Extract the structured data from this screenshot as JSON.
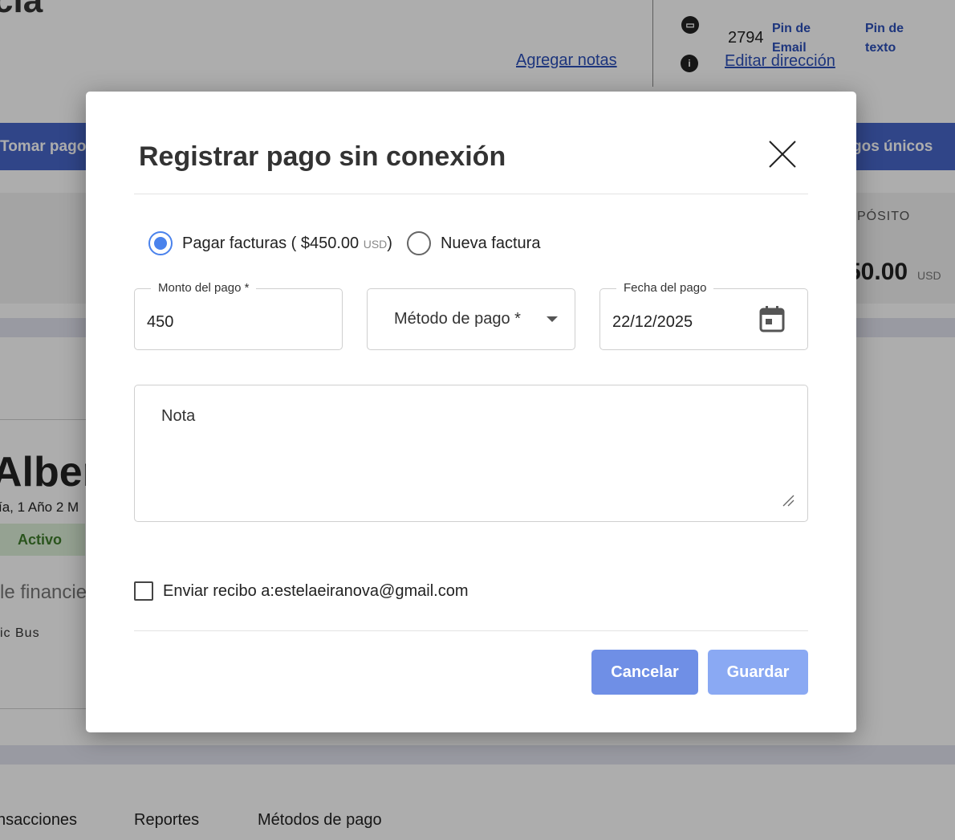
{
  "background": {
    "page_title_fragment": "cia",
    "add_notes_link": "Agregar notas",
    "edit_address_link": "Editar dirección",
    "pin_code": "2794",
    "pin_email_label": "Pin de Email",
    "pin_text_label": "Pin de texto",
    "take_payment_button": "Tomar pago",
    "one_time_charges_button": "gos únicos",
    "deposit_label": "PÓSITO",
    "deposit_amount": "50.00",
    "deposit_currency": "USD",
    "student_name": "Albert",
    "student_age": "ía, 1 Año 2 M",
    "status_badge": "Activo",
    "financial_fragment": "le financie",
    "bus_fragment": "ic Bus",
    "tabs": [
      "nsacciones",
      "Reportes",
      "Métodos de pago"
    ]
  },
  "modal": {
    "title": "Registrar pago sin conexión",
    "radio_options": {
      "pay_invoices_prefix": "Pagar facturas ( $450.00",
      "pay_invoices_currency": "USD",
      "pay_invoices_suffix": ")",
      "new_invoice": "Nueva factura",
      "selected": "pay_invoices"
    },
    "amount": {
      "label": "Monto del pago *",
      "value": "450"
    },
    "method": {
      "label": "Método de pago *"
    },
    "date": {
      "label": "Fecha del pago",
      "value": "22/12/2025"
    },
    "note": {
      "placeholder": "Nota"
    },
    "send_receipt": {
      "label": "Enviar recibo a:estelaeiranova@gmail.com",
      "checked": false
    },
    "buttons": {
      "cancel": "Cancelar",
      "save": "Guardar"
    }
  },
  "colors": {
    "accent_blue": "#4a82ec",
    "cancel_button": "#6f8fe6",
    "save_button": "#8aa9f3",
    "link_blue": "#2b4fb8",
    "status_green": "#3f7d2c"
  }
}
